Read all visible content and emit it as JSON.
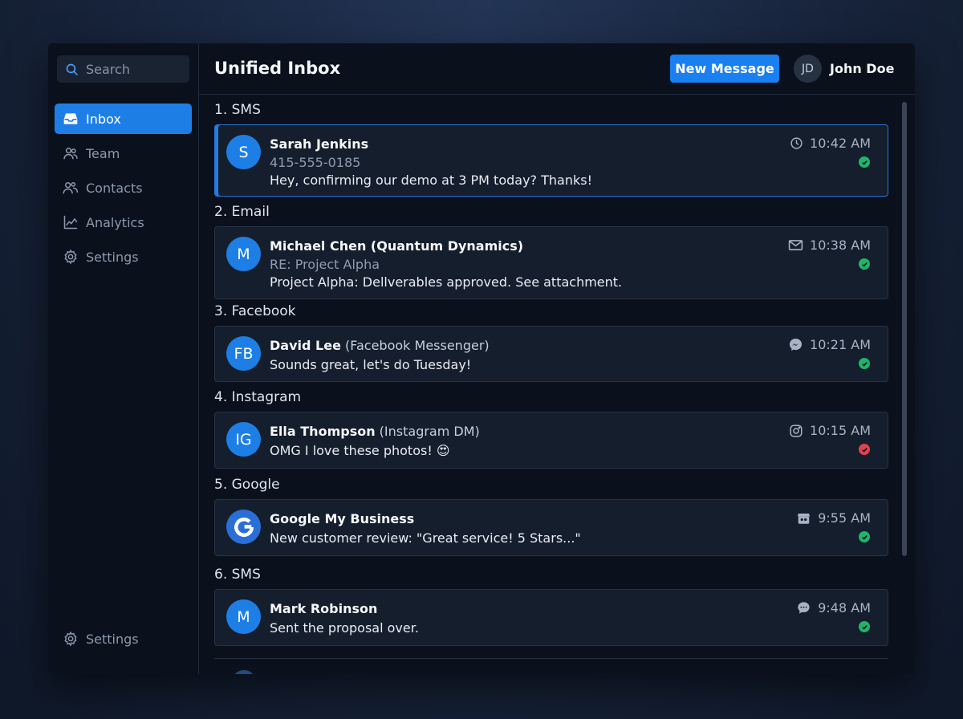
{
  "search": {
    "placeholder": "Search"
  },
  "sidebar": {
    "items": [
      {
        "label": "Inbox",
        "icon": "inbox-icon",
        "active": true
      },
      {
        "label": "Team",
        "icon": "team-icon"
      },
      {
        "label": "Contacts",
        "icon": "contacts-icon"
      },
      {
        "label": "Analytics",
        "icon": "analytics-icon"
      },
      {
        "label": "Settings",
        "icon": "gear-icon"
      }
    ],
    "bottom": {
      "label": "Settings",
      "icon": "gear-icon"
    }
  },
  "header": {
    "title": "Unified Inbox",
    "new_message_label": "New Message",
    "user": {
      "initials": "JD",
      "name": "John Doe"
    }
  },
  "messages": [
    {
      "section": "1. SMS",
      "initials": "S",
      "sender": "Sarah Jenkins",
      "source": "",
      "subline": "415-555-0185",
      "preview": "Hey, confirming our demo at 3 PM today? Thanks!",
      "time": "10:42 AM",
      "channel_icon": "clock-icon",
      "status": "delivered",
      "selected": true
    },
    {
      "section": "2. Email",
      "initials": "M",
      "sender": "Michael Chen (Quantum Dynamics)",
      "source": "",
      "subline": "RE: Project Alpha",
      "preview": "Project Alpha: Dellverables approved. See attachment.",
      "time": "10:38 AM",
      "channel_icon": "mail-icon",
      "status": "delivered"
    },
    {
      "section": "3. Facebook",
      "initials": "FB",
      "sender": "David Lee",
      "source": " (Facebook Messenger)",
      "subline": "",
      "preview": "Sounds great, let's do Tuesday!",
      "time": "10:21 AM",
      "channel_icon": "messenger-icon",
      "status": "delivered"
    },
    {
      "section": "4. Instagram",
      "initials": "IG",
      "sender": "Ella Thompson",
      "source": " (Instagram DM)",
      "subline": "",
      "preview": "OMG I love these photos! 😍",
      "time": "10:15 AM",
      "channel_icon": "instagram-icon",
      "status": "failed"
    },
    {
      "section": "5. Google",
      "initials": "G",
      "sender": "Google My Business",
      "source": "",
      "subline": "",
      "preview": "New customer review: \"Great service! 5 Stars...\"",
      "time": "9:55 AM",
      "channel_icon": "store-icon",
      "status": "delivered"
    },
    {
      "section": "6. SMS",
      "initials": "M",
      "sender": "Mark Robinson",
      "source": "",
      "subline": "",
      "preview": "Sent the proposal over.",
      "time": "9:48 AM",
      "channel_icon": "chat-bubble-icon",
      "status": "delivered"
    }
  ],
  "colors": {
    "accent": "#1d7fe6",
    "ok": "#1fb56a",
    "error": "#e0434f"
  }
}
